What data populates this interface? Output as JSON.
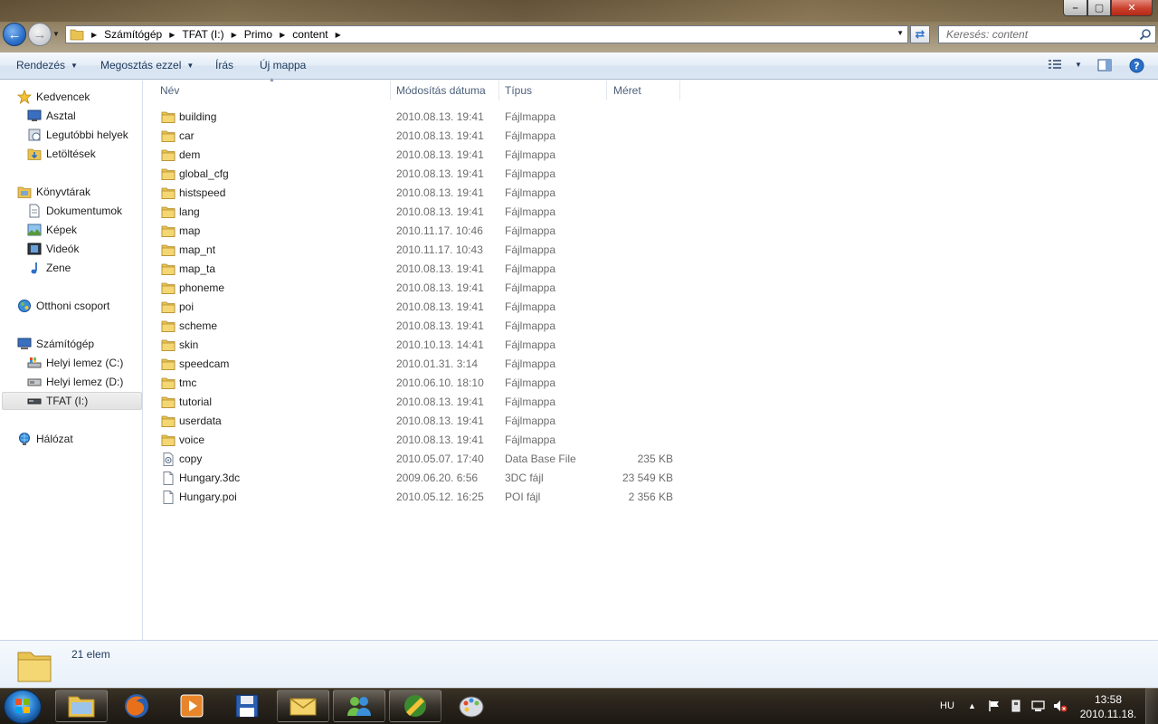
{
  "window": {
    "minimize_label": "–",
    "maximize_label": "▢",
    "close_label": "✕"
  },
  "address": {
    "breadcrumbs": [
      "Számítógép",
      "TFAT (I:)",
      "Primo",
      "content"
    ]
  },
  "search": {
    "placeholder": "Keresés: content"
  },
  "toolbar": {
    "organize": "Rendezés",
    "share": "Megosztás ezzel",
    "burn": "Írás",
    "new_folder": "Új mappa"
  },
  "nav": {
    "favorites": "Kedvencek",
    "desktop": "Asztal",
    "recent": "Legutóbbi helyek",
    "downloads": "Letöltések",
    "libraries": "Könyvtárak",
    "documents": "Dokumentumok",
    "pictures": "Képek",
    "videos": "Videók",
    "music": "Zene",
    "homegroup": "Otthoni csoport",
    "computer": "Számítógép",
    "drive_c": "Helyi lemez (C:)",
    "drive_d": "Helyi lemez (D:)",
    "drive_i": "TFAT (I:)",
    "network": "Hálózat"
  },
  "columns": {
    "name": "Név",
    "modified": "Módosítás dátuma",
    "type": "Típus",
    "size": "Méret"
  },
  "files": [
    {
      "name": "building",
      "date": "2010.08.13. 19:41",
      "type": "Fájlmappa",
      "size": "",
      "kind": "folder"
    },
    {
      "name": "car",
      "date": "2010.08.13. 19:41",
      "type": "Fájlmappa",
      "size": "",
      "kind": "folder"
    },
    {
      "name": "dem",
      "date": "2010.08.13. 19:41",
      "type": "Fájlmappa",
      "size": "",
      "kind": "folder"
    },
    {
      "name": "global_cfg",
      "date": "2010.08.13. 19:41",
      "type": "Fájlmappa",
      "size": "",
      "kind": "folder"
    },
    {
      "name": "histspeed",
      "date": "2010.08.13. 19:41",
      "type": "Fájlmappa",
      "size": "",
      "kind": "folder"
    },
    {
      "name": "lang",
      "date": "2010.08.13. 19:41",
      "type": "Fájlmappa",
      "size": "",
      "kind": "folder"
    },
    {
      "name": "map",
      "date": "2010.11.17. 10:46",
      "type": "Fájlmappa",
      "size": "",
      "kind": "folder"
    },
    {
      "name": "map_nt",
      "date": "2010.11.17. 10:43",
      "type": "Fájlmappa",
      "size": "",
      "kind": "folder"
    },
    {
      "name": "map_ta",
      "date": "2010.08.13. 19:41",
      "type": "Fájlmappa",
      "size": "",
      "kind": "folder"
    },
    {
      "name": "phoneme",
      "date": "2010.08.13. 19:41",
      "type": "Fájlmappa",
      "size": "",
      "kind": "folder"
    },
    {
      "name": "poi",
      "date": "2010.08.13. 19:41",
      "type": "Fájlmappa",
      "size": "",
      "kind": "folder"
    },
    {
      "name": "scheme",
      "date": "2010.08.13. 19:41",
      "type": "Fájlmappa",
      "size": "",
      "kind": "folder"
    },
    {
      "name": "skin",
      "date": "2010.10.13. 14:41",
      "type": "Fájlmappa",
      "size": "",
      "kind": "folder"
    },
    {
      "name": "speedcam",
      "date": "2010.01.31. 3:14",
      "type": "Fájlmappa",
      "size": "",
      "kind": "folder"
    },
    {
      "name": "tmc",
      "date": "2010.06.10. 18:10",
      "type": "Fájlmappa",
      "size": "",
      "kind": "folder"
    },
    {
      "name": "tutorial",
      "date": "2010.08.13. 19:41",
      "type": "Fájlmappa",
      "size": "",
      "kind": "folder"
    },
    {
      "name": "userdata",
      "date": "2010.08.13. 19:41",
      "type": "Fájlmappa",
      "size": "",
      "kind": "folder"
    },
    {
      "name": "voice",
      "date": "2010.08.13. 19:41",
      "type": "Fájlmappa",
      "size": "",
      "kind": "folder"
    },
    {
      "name": "copy",
      "date": "2010.05.07. 17:40",
      "type": "Data Base File",
      "size": "235 KB",
      "kind": "db"
    },
    {
      "name": "Hungary.3dc",
      "date": "2009.06.20. 6:56",
      "type": "3DC fájl",
      "size": "23 549 KB",
      "kind": "file"
    },
    {
      "name": "Hungary.poi",
      "date": "2010.05.12. 16:25",
      "type": "POI fájl",
      "size": "2 356 KB",
      "kind": "file"
    }
  ],
  "details": {
    "count": "21 elem"
  },
  "tray": {
    "lang": "HU",
    "time": "13:58",
    "date": "2010.11.18."
  },
  "icons": {
    "folder": "folder-icon",
    "file": "document-icon",
    "db": "database-file-icon"
  },
  "colors": {
    "folder": "#e8c352",
    "link_text": "#1e395b",
    "muted_text": "#6d6d6d",
    "close_button": "#c9402c"
  }
}
